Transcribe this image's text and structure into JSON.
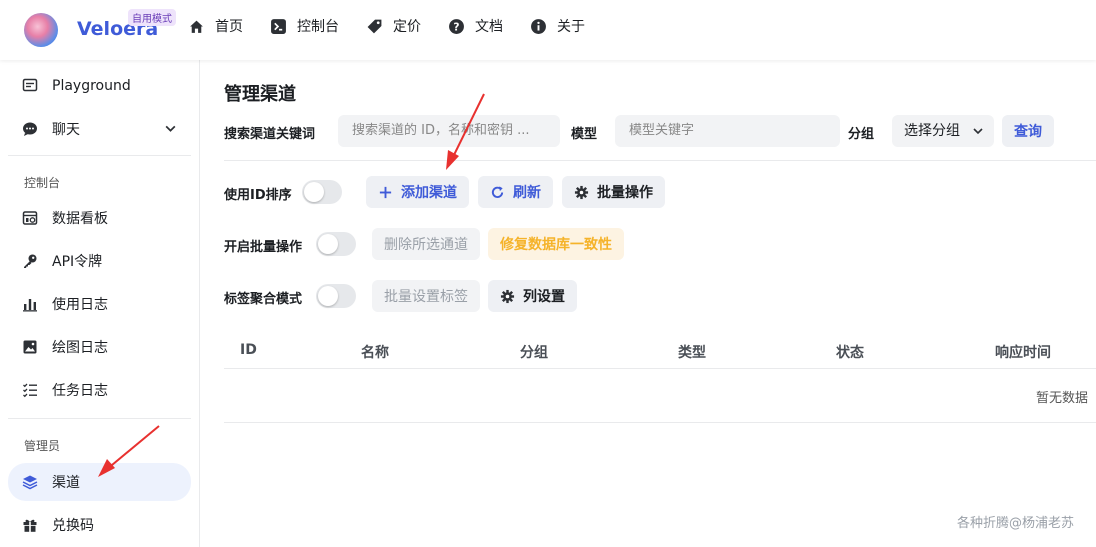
{
  "header": {
    "brand": "Veloera",
    "badge": "自用模式",
    "nav": [
      {
        "label": "首页",
        "icon": "home-icon"
      },
      {
        "label": "控制台",
        "icon": "terminal-icon"
      },
      {
        "label": "定价",
        "icon": "tag-icon"
      },
      {
        "label": "文档",
        "icon": "help-icon"
      },
      {
        "label": "关于",
        "icon": "info-icon"
      }
    ]
  },
  "sidebar": {
    "items": [
      {
        "label": "Playground",
        "icon": "chat-square-icon"
      },
      {
        "label": "聊天",
        "icon": "chat-bubble-icon"
      },
      {
        "label": "数据看板",
        "icon": "dashboard-icon"
      },
      {
        "label": "API令牌",
        "icon": "key-icon"
      },
      {
        "label": "使用日志",
        "icon": "bar-chart-icon"
      },
      {
        "label": "绘图日志",
        "icon": "image-icon"
      },
      {
        "label": "任务日志",
        "icon": "list-icon"
      },
      {
        "label": "渠道",
        "icon": "layers-icon"
      },
      {
        "label": "兑换码",
        "icon": "gift-icon"
      }
    ],
    "group_console": "控制台",
    "group_admin": "管理员"
  },
  "main": {
    "title": "管理渠道",
    "search_label": "搜索渠道关键词",
    "search_placeholder": "搜索渠道的 ID，名称和密钥 ...",
    "model_label": "模型",
    "model_placeholder": "模型关键字",
    "group_label": "分组",
    "group_select": "选择分组",
    "query_button": "查询",
    "sort_by_id": "使用ID排序",
    "add_channel": "添加渠道",
    "refresh": "刷新",
    "batch_ops": "批量操作",
    "enable_batch": "开启批量操作",
    "delete_selected": "删除所选通道",
    "fix_db": "修复数据库一致性",
    "tag_mode": "标签聚合模式",
    "batch_tag": "批量设置标签",
    "column_settings": "列设置",
    "columns": [
      "ID",
      "名称",
      "分组",
      "类型",
      "状态",
      "响应时间"
    ],
    "empty": "暂无数据"
  },
  "watermark": "各种折腾@杨浦老苏",
  "colors": {
    "accent": "#3f5bd8",
    "warning": "#f5b32a",
    "annotation": "#e8312f"
  }
}
